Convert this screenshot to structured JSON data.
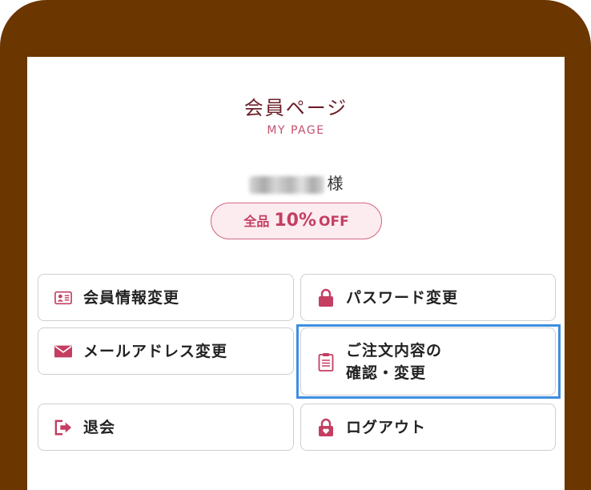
{
  "page": {
    "title": "会員ページ",
    "subtitle": "MY PAGE"
  },
  "user": {
    "honorific": "様"
  },
  "discount": {
    "prefix": "全品",
    "amount": "10%",
    "suffix": "OFF"
  },
  "menu": [
    {
      "label": "会員情報変更",
      "icon": "member-card-icon"
    },
    {
      "label": "パスワード変更",
      "icon": "lock-icon"
    },
    {
      "label": "メールアドレス変更",
      "icon": "mail-icon"
    },
    {
      "label_line1": "ご注文内容の",
      "label_line2": "確認・変更",
      "icon": "clipboard-icon",
      "selected": true
    },
    {
      "label": "退会",
      "icon": "exit-icon"
    },
    {
      "label": "ログアウト",
      "icon": "logout-lock-icon"
    }
  ],
  "colors": {
    "frame": "#6b3600",
    "accent": "#c43e62",
    "title": "#6a1f28",
    "selection": "#3d8fe0"
  }
}
